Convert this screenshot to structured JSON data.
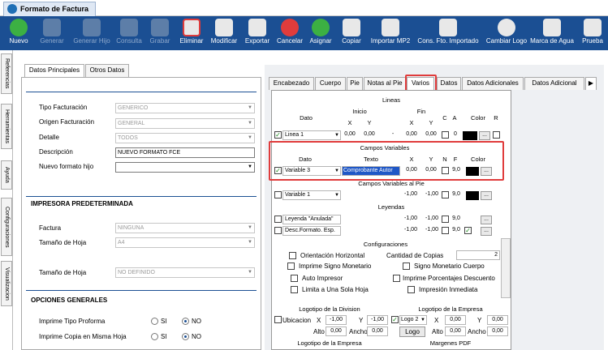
{
  "window": {
    "title": "Formato de Factura"
  },
  "toolbar": {
    "items": [
      {
        "label": "Nuevo",
        "icon": "new-icon",
        "enabled": true
      },
      {
        "label": "Generar",
        "icon": "generate-icon",
        "enabled": false
      },
      {
        "label": "Generar Hijo",
        "icon": "generate-child-icon",
        "enabled": false
      },
      {
        "label": "Consulta",
        "icon": "query-icon",
        "enabled": false
      },
      {
        "label": "Grabar",
        "icon": "save-icon",
        "enabled": false
      },
      {
        "label": "Eliminar",
        "icon": "delete-icon",
        "enabled": true
      },
      {
        "label": "Modificar",
        "icon": "edit-icon",
        "enabled": true
      },
      {
        "label": "Exportar",
        "icon": "export-icon",
        "enabled": true
      },
      {
        "label": "Cancelar",
        "icon": "cancel-icon",
        "enabled": true
      },
      {
        "label": "Asignar",
        "icon": "assign-icon",
        "enabled": true
      },
      {
        "label": "Copiar",
        "icon": "copy-icon",
        "enabled": true
      },
      {
        "label": "Importar MP2",
        "icon": "import-icon",
        "enabled": true
      },
      {
        "label": "Cons. Fto. Importado",
        "icon": "imported-format-icon",
        "enabled": true
      },
      {
        "label": "Cambiar Logo",
        "icon": "logo-icon",
        "enabled": true
      },
      {
        "label": "Marca de Agua",
        "icon": "watermark-icon",
        "enabled": true
      },
      {
        "label": "Prueba",
        "icon": "test-print-icon",
        "enabled": true
      }
    ]
  },
  "side_tabs": [
    "Referencias",
    "Herramientas",
    "Ayuda",
    "Configuraciones",
    "Visualizacion"
  ],
  "left_tabs": [
    "Datos Principales",
    "Otros Datos"
  ],
  "form": {
    "tipo_facturacion": {
      "label": "Tipo Facturación",
      "value": "GENERICO"
    },
    "origen_facturacion": {
      "label": "Origen Facturación",
      "value": "GENERAL"
    },
    "detalle": {
      "label": "Detalle",
      "value": "TODOS"
    },
    "descripcion": {
      "label": "Descripción",
      "value": "NUEVO FORMATO FCE"
    },
    "nuevo_formato_hijo": {
      "label": "Nuevo formato hijo",
      "value": ""
    }
  },
  "impresora": {
    "title": "IMPRESORA PREDETERMINADA",
    "factura": {
      "label": "Factura",
      "value": "NINGUNA"
    },
    "tamano": {
      "label": "Tamaño de Hoja",
      "value": "A4"
    },
    "tamano2": {
      "label": "Tamaño de Hoja",
      "value": "NO DEFINIDO"
    }
  },
  "opciones": {
    "title": "OPCIONES GENERALES",
    "proforma": {
      "label": "Imprime Tipo Proforma",
      "si": "SI",
      "no": "NO",
      "selected": "NO"
    },
    "copia": {
      "label": "Imprime Copia en Misma Hoja",
      "si": "SI",
      "no": "NO",
      "selected": "NO"
    }
  },
  "right_tabs": [
    "Encabezado",
    "Cuerpo",
    "Pie",
    "Notas al Pie",
    "Varios",
    "Datos",
    "Datos Adicionales",
    "Datos Adicional"
  ],
  "lineas": {
    "title": "Lineas",
    "dato": "Dato",
    "inicio": "Inicio",
    "fin": "Fin",
    "x": "X",
    "y": "Y",
    "c": "C",
    "a": "A",
    "color": "Color",
    "r": "R",
    "row": {
      "name": "Linea 1",
      "ix": "0,00",
      "iy": "0,00",
      "dash": "-",
      "fx": "0,00",
      "fy": "0,00",
      "c": "0"
    }
  },
  "campos": {
    "title": "Campos Variables",
    "dato": "Dato",
    "texto": "Texto",
    "x": "X",
    "y": "Y",
    "n": "N",
    "f": "F",
    "color": "Color",
    "row": {
      "name": "Variable 3",
      "texto": "Comprobante Autor",
      "x": "0,00",
      "y": "0,00",
      "f": "9,0"
    }
  },
  "campos_pie": {
    "title": "Campos Variables al Pie",
    "row": {
      "name": "Variable 1",
      "x": "-1,00",
      "y": "-1,00",
      "f": "9,0"
    }
  },
  "leyendas": {
    "title": "Leyendas",
    "rows": [
      {
        "name": "Leyenda \"Anulada\"",
        "x": "-1,00",
        "y": "-1,00",
        "f": "9,0"
      },
      {
        "name": "Desc.Formato. Esp.",
        "x": "-1,00",
        "y": "-1,00",
        "f": "9,0"
      }
    ]
  },
  "configuraciones": {
    "title": "Configuraciones",
    "items": [
      "Orientación Horizontal",
      "Imprime Signo Monetario",
      "Auto Impresor",
      "Limita a Una Sola Hoja",
      "Signo Monetario Cuerpo",
      "Imprime Porcentajes Descuento",
      "Impresión Inmediata"
    ],
    "cantidad_label": "Cantidad de Copias",
    "cantidad": "2"
  },
  "logo_div": {
    "title": "Logotipo de la Division",
    "ubicacion": "Ubicacion",
    "x": "-1,00",
    "y": "-1,00",
    "alto": "0,00",
    "ancho": "0,00"
  },
  "logo_emp": {
    "title": "Logotipo de la Empresa",
    "select": "Logo 2",
    "logo_btn": "Logo",
    "x": "0,00",
    "y": "0,00",
    "alto": "0,00",
    "ancho": "0,00"
  },
  "footer": {
    "logo_emp2": "Logotipo de la Empresa",
    "margenes": "Margenes PDF"
  },
  "colors": {
    "toolbar": "#1b4f93",
    "highlight": "#e03c3c",
    "selected_text": "#1f57c6"
  }
}
